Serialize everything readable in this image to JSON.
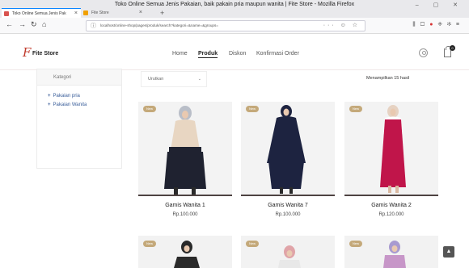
{
  "browser": {
    "window_title": "Toko Online Semua Jenis Pakaian, baik pakain pria maupun wanita | Fite Store - Mozilla Firefox",
    "tabs": [
      {
        "label": "Toko Online Semua Jenis Pak",
        "active": true
      },
      {
        "label": "Fite Store",
        "active": false
      }
    ],
    "url": "localhost/online-shop/pages/produk/search?kategori=&name=&groups=",
    "page_action_icons": "··· ☺ ☆"
  },
  "site": {
    "logo_mark": "F",
    "logo_text": "Fite Store",
    "menu": [
      {
        "label": "Home",
        "active": false
      },
      {
        "label": "Produk",
        "active": true
      },
      {
        "label": "Diskon",
        "active": false
      },
      {
        "label": "Konfirmasi Order",
        "active": false
      }
    ],
    "cart_count": "0"
  },
  "sidebar": {
    "title": "Kategori",
    "items": [
      "Pakaian pria",
      "Pakaian Wanita"
    ]
  },
  "toolbar": {
    "sort_label": "Urutkan",
    "results_text": "Menampilkan 15 hasil"
  },
  "products": [
    {
      "badge": "New",
      "name": "Gamis Wanita 1",
      "price": "Rp.100.000"
    },
    {
      "badge": "New",
      "name": "Gamis Wanita 7",
      "price": "Rp.100.000"
    },
    {
      "badge": "New",
      "name": "Gamis Wanita 2",
      "price": "Rp.120.000"
    }
  ],
  "products_row2": [
    {
      "badge": "New"
    },
    {
      "badge": "New"
    },
    {
      "badge": "New"
    }
  ],
  "colors": {
    "accent": "#c0392b",
    "badge": "#c4a97a",
    "link": "#3a5e9a"
  }
}
